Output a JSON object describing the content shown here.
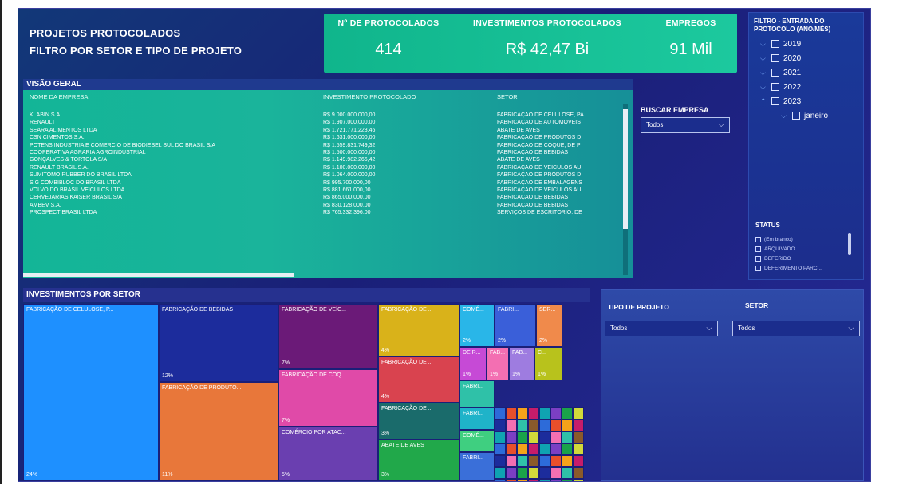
{
  "header": {
    "title_line1": "PROJETOS PROTOCOLADOS",
    "title_line2": "FILTRO POR SETOR E TIPO DE PROJETO"
  },
  "kpis": [
    {
      "label": "Nº DE PROTOCOLADOS",
      "value": "414"
    },
    {
      "label": "INVESTIMENTOS PROTOCOLADOS",
      "value": "R$ 42,47 Bi"
    },
    {
      "label": "EMPREGOS",
      "value": "91 Mil"
    }
  ],
  "date_filter": {
    "title": "FILTRO - ENTRADA DO PROTOCOLO (ANO/MÊS)",
    "years": [
      "2019",
      "2020",
      "2021",
      "2022",
      "2023"
    ],
    "month": "janeiro"
  },
  "status_filter": {
    "title": "STATUS",
    "options": [
      "(Em branco)",
      "ARQUIVADO",
      "DEFERIDO",
      "DEFERIMENTO PARC..."
    ]
  },
  "overview": {
    "title": "VISÃO GERAL",
    "columns": [
      "NOME DA EMPRESA",
      "INVESTIMENTO PROTOCOLADO",
      "SETOR"
    ],
    "rows": [
      [
        "KLABIN S.A.",
        "R$ 9.000.000.000,00",
        "FABRICAÇÃO DE CELULOSE, PA"
      ],
      [
        "RENAULT",
        "R$ 1.907.000.000,00",
        "FABRICAÇÃO DE AUTOMÓVEIS"
      ],
      [
        "SEARA ALIMENTOS LTDA",
        "R$ 1.721.771.223,46",
        "ABATE DE AVES"
      ],
      [
        "CSN CIMENTOS S.A.",
        "R$ 1.631.000.000,00",
        "FABRICAÇÃO DE PRODUTOS D"
      ],
      [
        "POTENS INDÚSTRIA E COMÉRCIO DE BIODIESEL SUL DO BRASIL S/A",
        "R$ 1.559.831.749,32",
        "FABRICAÇÃO DE COQUE, DE P"
      ],
      [
        "COOPERATIVA AGRÁRIA AGROINDUSTRIAL",
        "R$ 1.500.000.000,00",
        "FABRICAÇÃO DE BEBIDAS"
      ],
      [
        "GONÇALVES & TORTOLA S/A",
        "R$ 1.149.982.266,42",
        "ABATE DE AVES"
      ],
      [
        "RENAULT BRASIL S.A.",
        "R$ 1.100.000.000,00",
        "FABRICAÇÃO DE VEÍCULOS AU"
      ],
      [
        "SUMITOMO RUBBER DO BRASIL LTDA",
        "R$ 1.064.000.000,00",
        "FABRICAÇÃO DE PRODUTOS D"
      ],
      [
        "SIG COMBIBLOC DO BRASIL LTDA",
        "R$ 995.700.000,00",
        "FABRICAÇÃO DE EMBALAGENS"
      ],
      [
        "VOLVO DO BRASIL VEÍCULOS LTDA",
        "R$ 881.661.000,00",
        "FABRICAÇÃO DE VEÍCULOS AU"
      ],
      [
        "CERVEJARIAS KAISER BRASIL S/A",
        "R$ 865.000.000,00",
        "FABRICAÇÃO DE BEBIDAS"
      ],
      [
        "AMBEV S.A.",
        "R$ 830.128.000,00",
        "FABRICAÇÃO DE BEBIDAS"
      ],
      [
        "PROSPECT BRASIL LTDA",
        "R$ 765.332.396,00",
        "SERVIÇOS DE ESCRITÓRIO, DE"
      ]
    ]
  },
  "search_company": {
    "title": "BUSCAR EMPRESA",
    "value": "Todos"
  },
  "treemap": {
    "title": "INVESTIMENTOS POR SETOR",
    "tiles": [
      {
        "label": "FABRICAÇÃO DE CELULOSE, P...",
        "pct": "24%",
        "color": "#1e90ff"
      },
      {
        "label": "FABRICAÇÃO DE BEBIDAS",
        "pct": "12%",
        "color": "#1c2c9c"
      },
      {
        "label": "FABRICAÇÃO DE PRODUTO...",
        "pct": "11%",
        "color": "#e8773a"
      },
      {
        "label": "FABRICAÇÃO DE VEÍC...",
        "pct": "7%",
        "color": "#6b1a78"
      },
      {
        "label": "FABRICAÇÃO DE COQ...",
        "pct": "7%",
        "color": "#e04aa8"
      },
      {
        "label": "COMÉRCIO POR ATAC...",
        "pct": "5%",
        "color": "#6a3fb0"
      },
      {
        "label": "FABRICAÇÃO DE ...",
        "pct": "4%",
        "color": "#d9b21a"
      },
      {
        "label": "FABRICAÇÃO DE ...",
        "pct": "4%",
        "color": "#d9434f"
      },
      {
        "label": "FABRICAÇÃO DE ...",
        "pct": "3%",
        "color": "#1a6b6b"
      },
      {
        "label": "ABATE DE AVES",
        "pct": "3%",
        "color": "#21a84a"
      },
      {
        "label": "COMÉ...",
        "pct": "2%",
        "color": "#29b6e8"
      },
      {
        "label": "FABRI...",
        "pct": "2%",
        "color": "#3a5fd9"
      },
      {
        "label": "SER...",
        "pct": "2%",
        "color": "#f08a4b"
      },
      {
        "label": "DE R...",
        "pct": "1%",
        "color": "#c64ad6"
      },
      {
        "label": "FAB...",
        "pct": "1%",
        "color": "#f36fb2"
      },
      {
        "label": "FAB...",
        "pct": "1%",
        "color": "#9e7ce0"
      },
      {
        "label": "C...",
        "pct": "1%",
        "color": "#b8c21c"
      },
      {
        "label": "FABRI...",
        "pct": "",
        "color": "#2fc1a8"
      },
      {
        "label": "FABRI...",
        "pct": "",
        "color": "#1fb3c9"
      },
      {
        "label": "COMÉ...",
        "pct": "",
        "color": "#3fcf80"
      },
      {
        "label": "FABRI...",
        "pct": "",
        "color": "#3a6fd9"
      }
    ]
  },
  "project_type": {
    "title": "TIPO DE PROJETO",
    "value": "Todos"
  },
  "sector": {
    "title": "SETOR",
    "value": "Todos"
  }
}
